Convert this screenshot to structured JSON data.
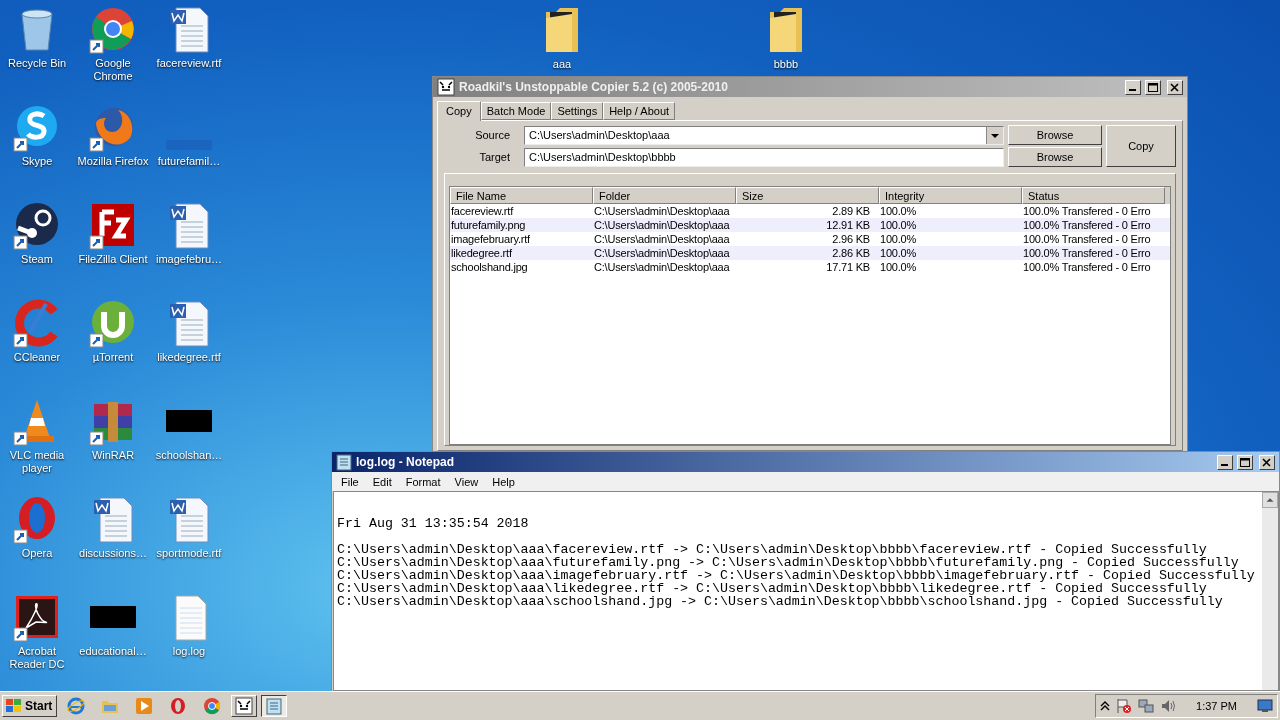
{
  "desktop": {
    "icons": [
      {
        "label": "Recycle Bin",
        "kind": "recycle",
        "shortcut": false
      },
      {
        "label": "Google Chrome",
        "kind": "chrome",
        "shortcut": true
      },
      {
        "label": "facereview.rtf",
        "kind": "word",
        "shortcut": false
      },
      {
        "label": "Skype",
        "kind": "skype",
        "shortcut": true
      },
      {
        "label": "Mozilla Firefox",
        "kind": "firefox",
        "shortcut": true
      },
      {
        "label": "futurefamil…",
        "kind": "blank",
        "shortcut": false
      },
      {
        "label": "Steam",
        "kind": "steam",
        "shortcut": true
      },
      {
        "label": "FileZilla Client",
        "kind": "filezilla",
        "shortcut": true
      },
      {
        "label": "imagefebru…",
        "kind": "word",
        "shortcut": false
      },
      {
        "label": "CCleaner",
        "kind": "ccleaner",
        "shortcut": true
      },
      {
        "label": "µTorrent",
        "kind": "utorrent",
        "shortcut": true
      },
      {
        "label": "likedegree.rtf",
        "kind": "word",
        "shortcut": false
      },
      {
        "label": "VLC media player",
        "kind": "vlc",
        "shortcut": true
      },
      {
        "label": "WinRAR",
        "kind": "winrar",
        "shortcut": true
      },
      {
        "label": "schoolshan…",
        "kind": "black",
        "shortcut": false
      },
      {
        "label": "Opera",
        "kind": "opera",
        "shortcut": true
      },
      {
        "label": "discussions…",
        "kind": "word",
        "shortcut": false
      },
      {
        "label": "sportmode.rtf",
        "kind": "word",
        "shortcut": false
      },
      {
        "label": "Acrobat Reader DC",
        "kind": "acrobat",
        "shortcut": true
      },
      {
        "label": "educational…",
        "kind": "black",
        "shortcut": false
      },
      {
        "label": "log.log",
        "kind": "text",
        "shortcut": false
      }
    ],
    "folders": [
      {
        "label": "aaa"
      },
      {
        "label": "bbbb"
      }
    ]
  },
  "copier": {
    "title": "Roadkil's Unstoppable Copier 5.2 (c) 2005-2010",
    "tabs": [
      {
        "label": "Copy",
        "selected": true
      },
      {
        "label": "Batch Mode",
        "selected": false
      },
      {
        "label": "Settings",
        "selected": false
      },
      {
        "label": "Help / About",
        "selected": false
      }
    ],
    "source": {
      "label": "Source",
      "value": "C:\\Users\\admin\\Desktop\\aaa"
    },
    "target": {
      "label": "Target",
      "value": "C:\\Users\\admin\\Desktop\\bbbb"
    },
    "browse_buttons": [
      "Browse",
      "Browse"
    ],
    "copy_button": "Copy",
    "table": {
      "columns": [
        "File Name",
        "Folder",
        "Size",
        "Integrity",
        "Status"
      ],
      "rows": [
        [
          "facereview.rtf",
          "C:\\Users\\admin\\Desktop\\aaa",
          "2.89 KB",
          "100.0%",
          "100.0% Transfered - 0 Erro"
        ],
        [
          "futurefamily.png",
          "C:\\Users\\admin\\Desktop\\aaa",
          "12.91 KB",
          "100.0%",
          "100.0% Transfered - 0 Erro"
        ],
        [
          "imagefebruary.rtf",
          "C:\\Users\\admin\\Desktop\\aaa",
          "2.96 KB",
          "100.0%",
          "100.0% Transfered - 0 Erro"
        ],
        [
          "likedegree.rtf",
          "C:\\Users\\admin\\Desktop\\aaa",
          "2.86 KB",
          "100.0%",
          "100.0% Transfered - 0 Erro"
        ],
        [
          "schoolshand.jpg",
          "C:\\Users\\admin\\Desktop\\aaa",
          "17.71 KB",
          "100.0%",
          "100.0% Transfered - 0 Erro"
        ]
      ]
    }
  },
  "notepad": {
    "title": "log.log - Notepad",
    "menu": [
      "File",
      "Edit",
      "Format",
      "View",
      "Help"
    ],
    "header": "Fri Aug 31 13:35:54 2018",
    "lines": [
      "C:\\Users\\admin\\Desktop\\aaa\\facereview.rtf -> C:\\Users\\admin\\Desktop\\bbbb\\facereview.rtf - Copied Successfully",
      "C:\\Users\\admin\\Desktop\\aaa\\futurefamily.png -> C:\\Users\\admin\\Desktop\\bbbb\\futurefamily.png - Copied Successfully",
      "C:\\Users\\admin\\Desktop\\aaa\\imagefebruary.rtf -> C:\\Users\\admin\\Desktop\\bbbb\\imagefebruary.rtf - Copied Successfully",
      "C:\\Users\\admin\\Desktop\\aaa\\likedegree.rtf -> C:\\Users\\admin\\Desktop\\bbbb\\likedegree.rtf - Copied Successfully",
      "C:\\Users\\admin\\Desktop\\aaa\\schoolshand.jpg -> C:\\Users\\admin\\Desktop\\bbbb\\schoolshand.jpg - Copied Successfully"
    ]
  },
  "taskbar": {
    "start": "Start",
    "quick_launch": [
      {
        "kind": "ie"
      },
      {
        "kind": "explorer"
      },
      {
        "kind": "media"
      },
      {
        "kind": "opera"
      },
      {
        "kind": "chrome"
      }
    ],
    "tasks": [
      {
        "kind": "copier",
        "selected": false
      },
      {
        "kind": "notepad",
        "selected": true
      }
    ],
    "clock": "1:37 PM"
  }
}
